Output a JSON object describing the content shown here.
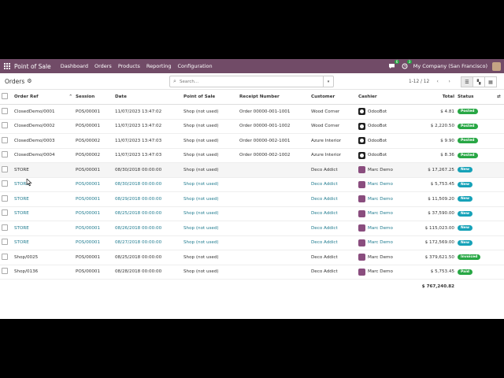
{
  "navbar": {
    "app_name": "Point of Sale",
    "menu": [
      "Dashboard",
      "Orders",
      "Products",
      "Reporting",
      "Configuration"
    ],
    "messages_count": "6",
    "activities_count": "3",
    "company": "My Company (San Francisco)"
  },
  "control": {
    "breadcrumb": "Orders",
    "search_placeholder": "Search...",
    "pager": "1-12 / 12"
  },
  "table": {
    "headers": {
      "order_ref": "Order Ref",
      "session": "Session",
      "date": "Date",
      "pos": "Point of Sale",
      "receipt": "Receipt Number",
      "customer": "Customer",
      "cashier": "Cashier",
      "total": "Total",
      "status": "Status"
    },
    "rows": [
      {
        "ref": "ClosedDemo/0001",
        "session": "POS/00001",
        "date": "11/07/2023 13:47:02",
        "pos": "Shop (not used)",
        "receipt": "Order 00000-001-1001",
        "customer": "Wood Corner",
        "cashier": "OdooBot",
        "total": "$ 4.81",
        "status": "Posted"
      },
      {
        "ref": "ClosedDemo/0002",
        "session": "POS/00001",
        "date": "11/07/2023 13:47:02",
        "pos": "Shop (not used)",
        "receipt": "Order 00000-001-1002",
        "customer": "Wood Corner",
        "cashier": "OdooBot",
        "total": "$ 2,220.50",
        "status": "Posted"
      },
      {
        "ref": "ClosedDemo/0003",
        "session": "POS/00002",
        "date": "11/07/2023 13:47:03",
        "pos": "Shop (not used)",
        "receipt": "Order 00000-002-1001",
        "customer": "Azure Interior",
        "cashier": "OdooBot",
        "total": "$ 9.90",
        "status": "Posted"
      },
      {
        "ref": "ClosedDemo/0004",
        "session": "POS/00002",
        "date": "11/07/2023 13:47:03",
        "pos": "Shop (not used)",
        "receipt": "Order 00000-002-1002",
        "customer": "Azure Interior",
        "cashier": "OdooBot",
        "total": "$ 8.36",
        "status": "Posted"
      },
      {
        "ref": "STORE",
        "session": "POS/00001",
        "date": "08/30/2018 00:00:00",
        "pos": "Shop (not used)",
        "receipt": "",
        "customer": "Deco Addict",
        "cashier": "Marc Demo",
        "total": "$ 17,267.25",
        "status": "New"
      },
      {
        "ref": "STORE",
        "session": "POS/00001",
        "date": "08/30/2018 00:00:00",
        "pos": "Shop (not used)",
        "receipt": "",
        "customer": "Deco Addict",
        "cashier": "Marc Demo",
        "total": "$ 5,753.45",
        "status": "New"
      },
      {
        "ref": "STORE",
        "session": "POS/00001",
        "date": "08/29/2018 00:00:00",
        "pos": "Shop (not used)",
        "receipt": "",
        "customer": "Deco Addict",
        "cashier": "Marc Demo",
        "total": "$ 11,509.20",
        "status": "New"
      },
      {
        "ref": "STORE",
        "session": "POS/00001",
        "date": "08/25/2018 00:00:00",
        "pos": "Shop (not used)",
        "receipt": "",
        "customer": "Deco Addict",
        "cashier": "Marc Demo",
        "total": "$ 37,590.00",
        "status": "New"
      },
      {
        "ref": "STORE",
        "session": "POS/00001",
        "date": "08/26/2018 00:00:00",
        "pos": "Shop (not used)",
        "receipt": "",
        "customer": "Deco Addict",
        "cashier": "Marc Demo",
        "total": "$ 115,023.00",
        "status": "New"
      },
      {
        "ref": "STORE",
        "session": "POS/00001",
        "date": "08/27/2018 00:00:00",
        "pos": "Shop (not used)",
        "receipt": "",
        "customer": "Deco Addict",
        "cashier": "Marc Demo",
        "total": "$ 172,569.00",
        "status": "New"
      },
      {
        "ref": "Shop/0025",
        "session": "POS/00001",
        "date": "08/25/2018 00:00:00",
        "pos": "Shop (not used)",
        "receipt": "",
        "customer": "Deco Addict",
        "cashier": "Marc Demo",
        "total": "$ 379,621.50",
        "status": "Invoiced"
      },
      {
        "ref": "Shop/0136",
        "session": "POS/00001",
        "date": "08/28/2018 00:00:00",
        "pos": "Shop (not used)",
        "receipt": "",
        "customer": "Deco Addict",
        "cashier": "Marc Demo",
        "total": "$ 5,753.45",
        "status": "Paid"
      }
    ],
    "grand_total": "$ 767,240.82"
  },
  "colors": {
    "navbar": "#714b67",
    "posted": "#28a745",
    "new": "#17a2b8",
    "invoiced": "#28a745",
    "paid": "#28a745",
    "link": "#1f7b8f"
  }
}
